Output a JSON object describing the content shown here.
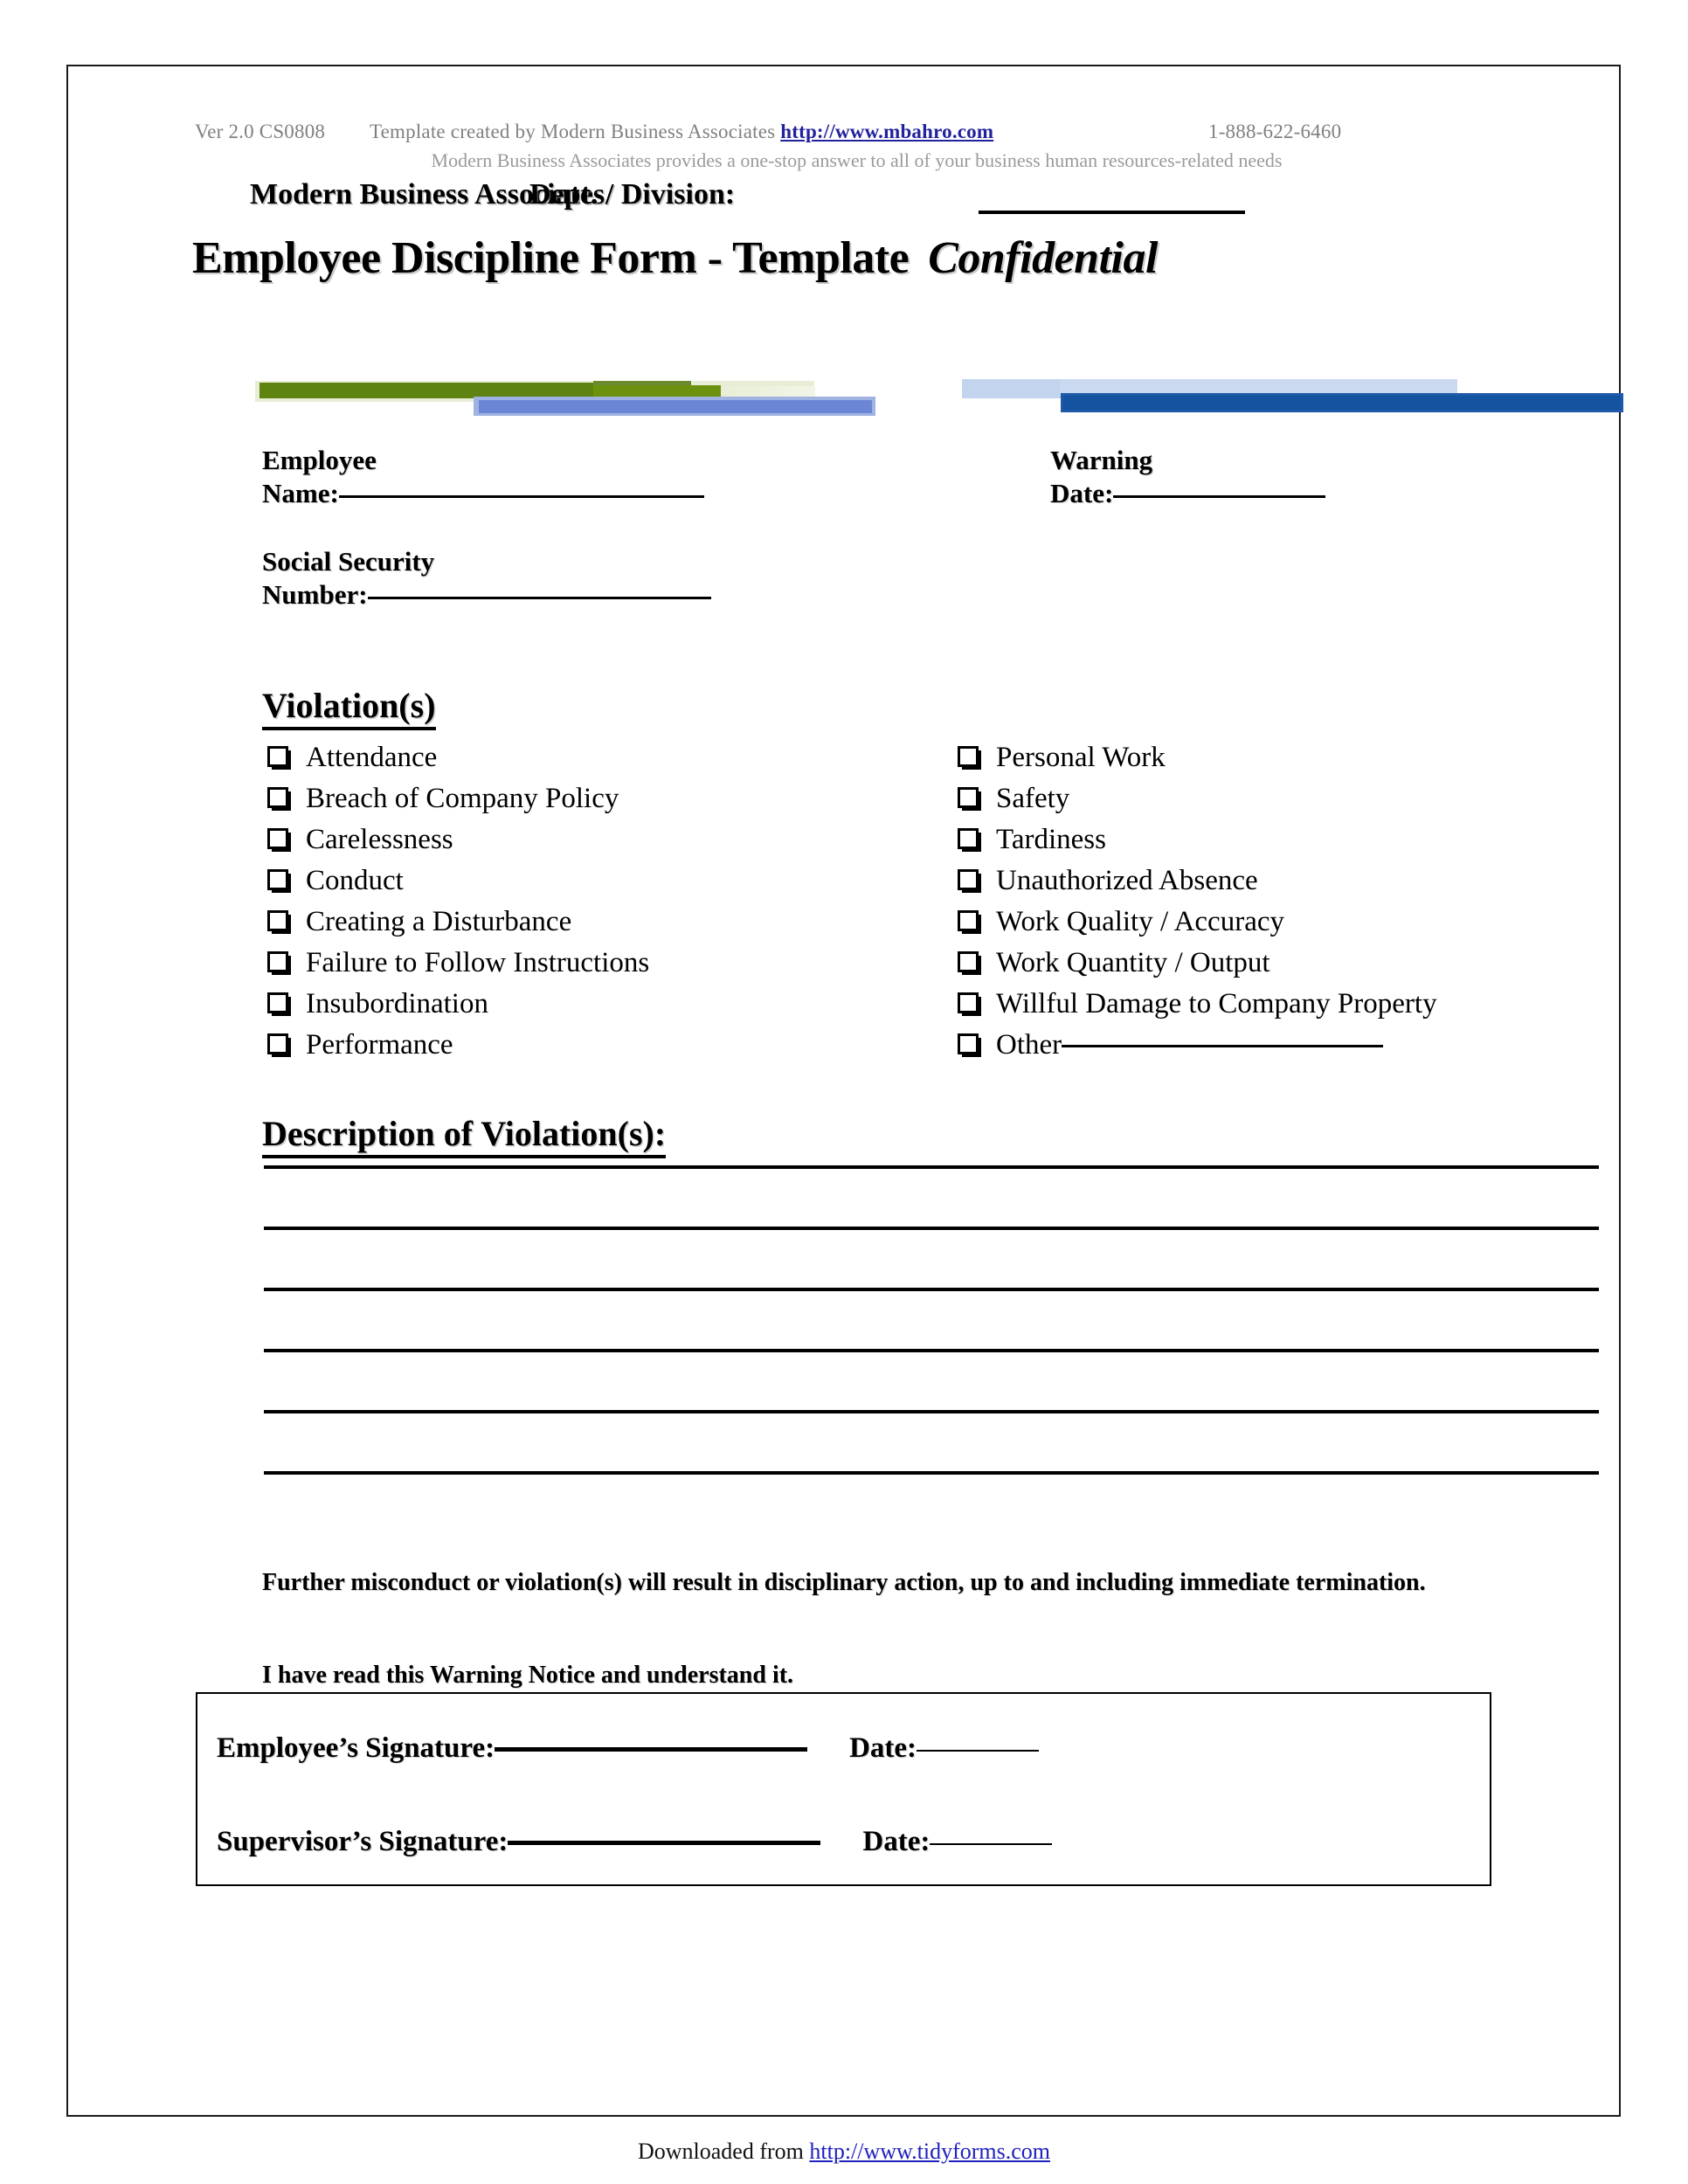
{
  "masthead": {
    "version": "Ver 2.0 CS0808",
    "created_by": "Template created by Modern Business Associates",
    "url": "http://www.mbahro.com",
    "phone": "1-888-622-6460",
    "tagline": "Modern Business Associates provides a one-stop answer to all of your business human resources-related needs"
  },
  "header": {
    "company_name": "Modern Business Associates",
    "dept_label": "Dept. / Division:",
    "title": "Employee Discipline Form - Template",
    "confidential": "Confidential"
  },
  "fields": {
    "employee_name_line1": "Employee",
    "employee_name_line2": "Name:",
    "warning_date_line1": "Warning",
    "warning_date_line2": "Date:",
    "ssn_line1": "Social Security",
    "ssn_line2": "Number:"
  },
  "violations": {
    "heading": "Violation(s)",
    "left_column": [
      "Attendance",
      "Breach of Company Policy",
      "Carelessness",
      "Conduct",
      "Creating a Disturbance",
      "Failure to Follow Instructions",
      "Insubordination",
      "Performance"
    ],
    "right_column": [
      "Personal Work",
      "Safety",
      "Tardiness",
      "Unauthorized Absence",
      "Work Quality / Accuracy",
      "Work Quantity / Output",
      "Willful Damage to Company Property",
      "Other"
    ]
  },
  "description": {
    "heading": "Description of Violation(s):",
    "line_count": 6
  },
  "statements": {
    "warning": "Further misconduct or violation(s) will result in disciplinary action, up to and including immediate termination.",
    "acknowledgement": "I have read this Warning Notice and understand it."
  },
  "signatures": {
    "employee_label": "Employee’s Signature:",
    "supervisor_label": "Supervisor’s Signature:",
    "date_label": "Date:"
  },
  "footer": {
    "prefix": "Downloaded from ",
    "url": "http://www.tidyforms.com"
  },
  "colors": {
    "green": "#5f8310",
    "green_pale": "#e8eed6",
    "periwinkle": "#6b86d4",
    "light_blue": "#c3d4ef",
    "blue": "#1e5aa8",
    "link_blue": "#22229c",
    "footer_link_blue": "#2020c0",
    "masthead_gray": "#808080"
  }
}
